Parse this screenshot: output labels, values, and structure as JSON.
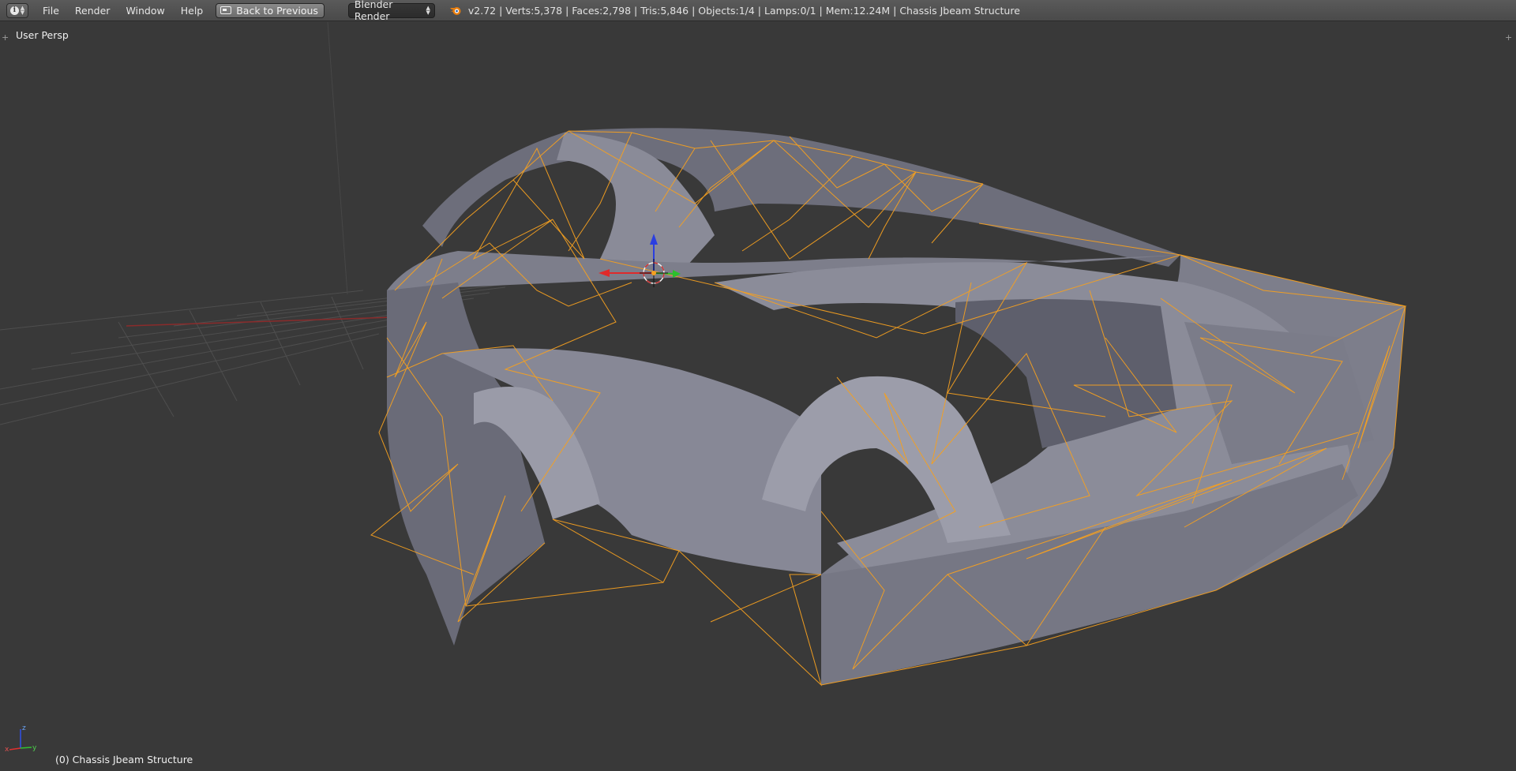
{
  "header": {
    "editor_type_icon": "info-icon",
    "menus": [
      "File",
      "Render",
      "Window",
      "Help"
    ],
    "back_button_label": "Back to Previous",
    "render_engine": "Blender Render",
    "stats": "v2.72 | Verts:5,378 | Faces:2,798 | Tris:5,846 | Objects:1/4 | Lamps:0/1 | Mem:12.24M | Chassis Jbeam Structure"
  },
  "viewport": {
    "view_label": "User Persp",
    "object_status": "(0) Chassis Jbeam Structure",
    "axis_labels": {
      "x": "x",
      "y": "y",
      "z": "z"
    }
  },
  "colors": {
    "header_bg": "#4d4d4d",
    "viewport_bg": "#393939",
    "grid_line": "#4d4d4d",
    "mesh_fill": "#7e7f8c",
    "wire_orange": "#f5a020",
    "axis_x": "#e03030",
    "axis_y": "#30c030",
    "axis_z": "#2040e0"
  }
}
